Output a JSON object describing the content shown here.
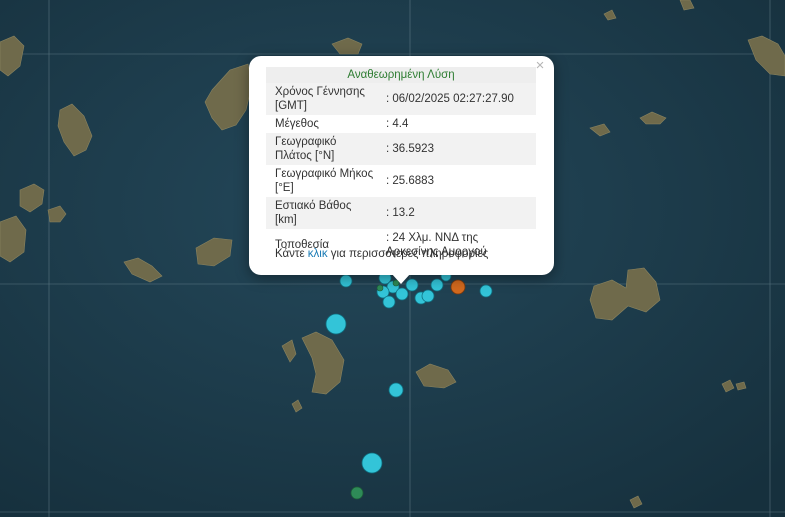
{
  "popup": {
    "header": "Αναθεωρημένη Λύση",
    "close_glyph": "×",
    "rows": [
      {
        "label": "Χρόνος Γέννησης [GMT]",
        "value": ": 06/02/2025 02:27:27.90"
      },
      {
        "label": "Μέγεθος",
        "value": ": 4.4"
      },
      {
        "label": "Γεωγραφικό Πλάτος [°N]",
        "value": ": 36.5923"
      },
      {
        "label": "Γεωγραφικό Μήκος [°E]",
        "value": ": 25.6883"
      },
      {
        "label": "Εστιακό Βάθος [km]",
        "value": ": 13.2"
      },
      {
        "label": "Τοποθεσία",
        "value": ": 24 Χλμ. ΝΝΔ της Αρκεσίνης Αμοργού"
      }
    ],
    "more_prefix": "Κάντε ",
    "more_link": "κλικ",
    "more_suffix": " για περισσότερες πληροφορίες"
  },
  "colors": {
    "sea": "#1f3a4a",
    "land": "#6b6548",
    "marker_cyan": "#33c4d8",
    "marker_orange": "#d2691e",
    "marker_green": "#2e8b57",
    "popup_header_text": "#2e7d32",
    "link": "#1a7bb5"
  }
}
